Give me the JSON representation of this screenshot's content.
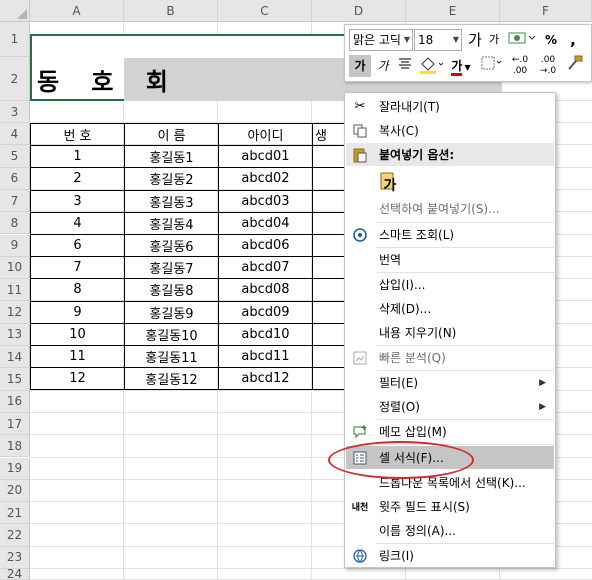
{
  "columns": [
    "A",
    "B",
    "C",
    "D",
    "E",
    "F"
  ],
  "rows": [
    "1",
    "2",
    "3",
    "4",
    "5",
    "6",
    "7",
    "8",
    "9",
    "10",
    "11",
    "12",
    "13",
    "14",
    "15",
    "16",
    "17",
    "18",
    "19",
    "20",
    "21",
    "22",
    "23",
    "24"
  ],
  "title": "동 호 회",
  "table": {
    "headers": [
      "번 호",
      "이 름",
      "아이디",
      "생"
    ],
    "rows": [
      [
        "1",
        "홍길동1",
        "abcd01"
      ],
      [
        "2",
        "홍길동2",
        "abcd02"
      ],
      [
        "3",
        "홍길동3",
        "abcd03"
      ],
      [
        "4",
        "홍길동4",
        "abcd04"
      ],
      [
        "6",
        "홍길동6",
        "abcd06"
      ],
      [
        "7",
        "홍길동7",
        "abcd07"
      ],
      [
        "8",
        "홍길동8",
        "abcd08"
      ],
      [
        "9",
        "홍길동9",
        "abcd09"
      ],
      [
        "10",
        "홍길동10",
        "abcd10"
      ],
      [
        "11",
        "홍길동11",
        "abcd11"
      ],
      [
        "12",
        "홍길동12",
        "abcd12"
      ]
    ]
  },
  "mini_toolbar": {
    "font_name": "맑은 고딕",
    "font_size": "18",
    "grow_font": "가",
    "shrink_font": "가",
    "percent": "%",
    "comma": ",",
    "bold": "가",
    "italic": "가",
    "font_color_label": "가",
    "inc_decimal": "←.0 .00",
    "dec_decimal": ".00 →.0"
  },
  "context_menu": {
    "cut": "잘라내기(T)",
    "copy": "복사(C)",
    "paste_options": "붙여넣기 옵션:",
    "paste_option_icon_label": "가",
    "paste_special": "선택하여 붙여넣기(S)...",
    "smart_lookup": "스마트 조회(L)",
    "translate": "번역",
    "insert": "삽입(I)...",
    "delete": "삭제(D)...",
    "clear_contents": "내용 지우기(N)",
    "quick_analysis": "빠른 분석(Q)",
    "filter": "필터(E)",
    "sort": "정렬(O)",
    "insert_comment": "메모 삽입(M)",
    "format_cells": "셀 서식(F)...",
    "pick_from_list": "드롭다운 목록에서 선택(K)...",
    "phonetic": "윗주 필드 표시(S)",
    "define_name": "이름 정의(A)...",
    "link": "링크(I)",
    "phonetic_icon_label": "내천"
  },
  "colors": {
    "selection_border": "#217346",
    "annotation": "#d42a2a",
    "highlight": "#c5c5c5"
  }
}
